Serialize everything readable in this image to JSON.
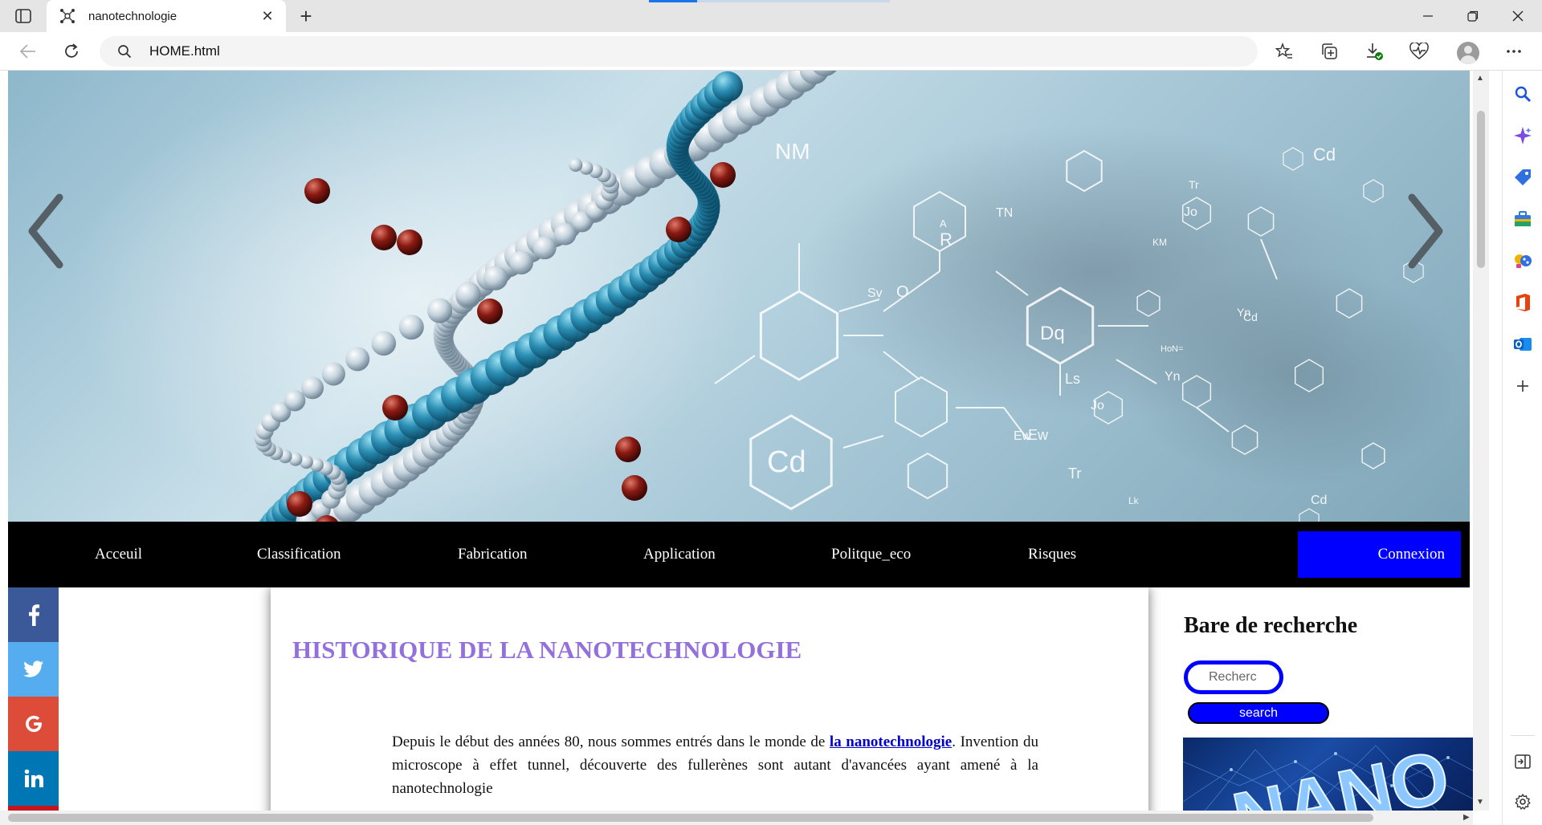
{
  "browser": {
    "tab_title": "nanotechnologie",
    "url": "HOME.html",
    "new_tab_glyph": "+",
    "close_glyph": "✕"
  },
  "icons": {
    "favicon": "molecule-icon",
    "back": "back-arrow-icon",
    "refresh": "refresh-icon",
    "address": "search-icon",
    "toolbar": [
      "favorites-star-icon",
      "collections-icon",
      "downloads-icon",
      "browser-essentials-icon",
      "profile-avatar-icon",
      "more-menu-icon"
    ],
    "edge_sidebar": [
      "search-icon",
      "copilot-icon",
      "shopping-tag-icon",
      "tools-briefcase-icon",
      "games-icon",
      "office-icon",
      "outlook-icon",
      "add-icon",
      "split-screen-icon",
      "settings-icon"
    ],
    "social": [
      "facebook-icon",
      "twitter-icon",
      "google-icon",
      "linkedin-icon"
    ]
  },
  "colors": {
    "nav_bg": "#000000",
    "login_bg": "#0000ff",
    "heading": "#9370db",
    "link": "#0000cc",
    "facebook": "#3b5998",
    "twitter": "#55acee",
    "google": "#dd4b39",
    "linkedin": "#0077b5"
  },
  "nav": {
    "items": [
      "Acceuil",
      "Classification",
      "Fabrication",
      "Application",
      "Politque_eco",
      "Risques"
    ],
    "login": "Connexion"
  },
  "article": {
    "title": "HISTORIQUE DE LA NANOTECHNOLOGIE",
    "para_before_link": "Depuis le début des années 80, nous sommes entrés dans le monde de ",
    "para_link": "la nanotechnologie",
    "para_after_link": ". Invention du microscope à effet tunnel, découverte des fullerènes sont autant d'avancées ayant amené à la nanotechnologie"
  },
  "aside": {
    "heading": "Bare de recherche",
    "search_placeholder": "Rechercher",
    "search_value": "Recherc",
    "search_button": "search",
    "banner_text": "NANO"
  },
  "hero_labels": [
    "NM",
    "Cd",
    "TN",
    "R",
    "Dq",
    "KM",
    "Jo",
    "Ls",
    "Ew",
    "Tr",
    "Yn",
    "HoN=",
    "Cd",
    "Jo",
    "Sv",
    "Tr",
    "Yn",
    "Cd",
    "Lk",
    "A",
    "O",
    "Ew",
    "Cd"
  ]
}
